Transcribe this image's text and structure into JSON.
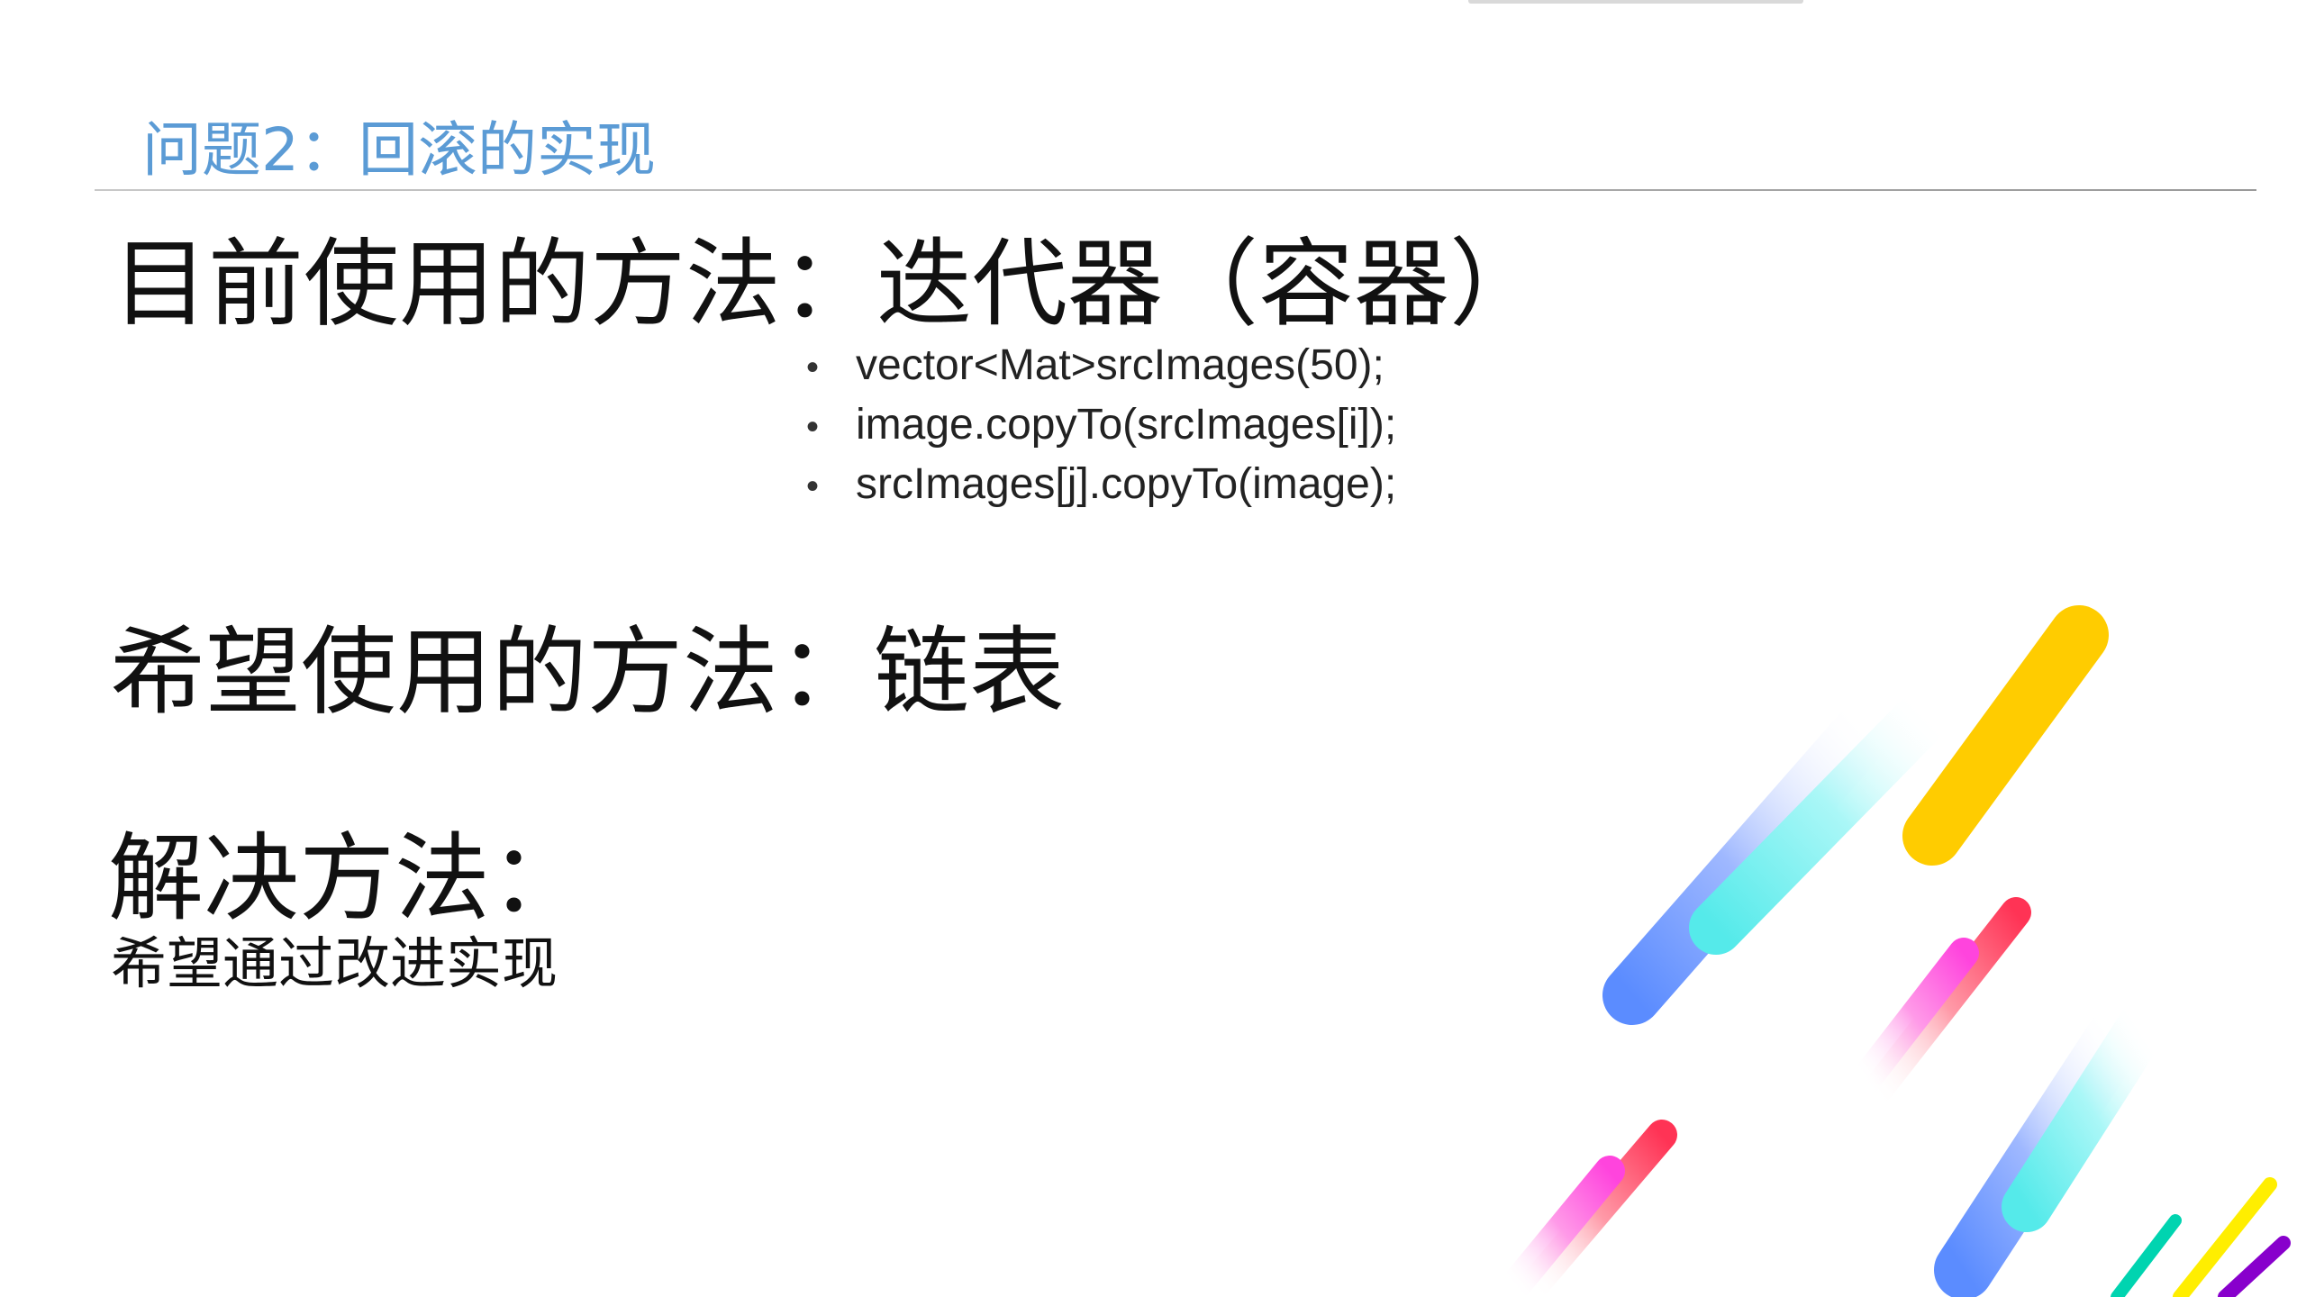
{
  "slide": {
    "title": "问题2：回滚的实现",
    "current_method": {
      "heading": "目前使用的方法：迭代器（容器）",
      "items": [
        "vector<Mat>srcImages(50);",
        "image.copyTo(srcImages[i]);",
        "srcImages[j].copyTo(image);"
      ],
      "bullet": "•"
    },
    "desired_method": {
      "heading": "希望使用的方法：链表"
    },
    "solution": {
      "heading": "解决方法：",
      "text": "希望通过改进实现"
    }
  },
  "colors": {
    "title": "#5b9bd5",
    "text": "#111111",
    "rule": "#a6a6a6",
    "deco_yellow": "#ffcc00",
    "deco_blue": "#5b8cff",
    "deco_cyan": "#66f0f0",
    "deco_magenta": "#ff44dd",
    "deco_red": "#ff3355",
    "deco_teal": "#00d4b0",
    "deco_purple": "#8800cc"
  }
}
